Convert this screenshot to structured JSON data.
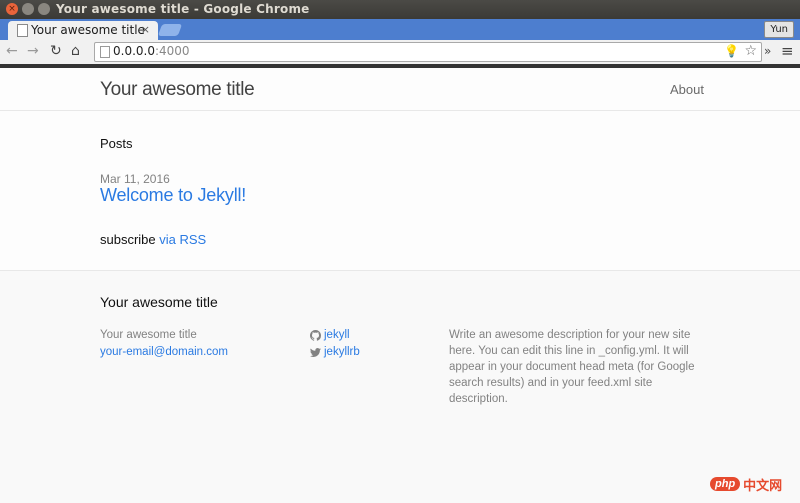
{
  "window": {
    "title": "Your awesome title - Google Chrome"
  },
  "browser": {
    "tab_title": "Your awesome title",
    "tab_close": "×",
    "profile_name": "Yun",
    "url_host": "0.0.0.0",
    "url_port": ":4000",
    "extensions_chevron": "»",
    "menu_glyph": "≡"
  },
  "site": {
    "title": "Your awesome title",
    "nav": [
      {
        "label": "About"
      }
    ]
  },
  "main": {
    "posts_heading": "Posts",
    "posts": [
      {
        "date": "Mar 11, 2016",
        "title": "Welcome to Jekyll!"
      }
    ],
    "subscribe_text": "subscribe",
    "subscribe_link": "via RSS"
  },
  "footer": {
    "heading": "Your awesome title",
    "name": "Your awesome title",
    "email": "your-email@domain.com",
    "github": {
      "icon": "github-icon",
      "username": "jekyll"
    },
    "twitter": {
      "icon": "twitter-icon",
      "username": "jekyllrb"
    },
    "description": "Write an awesome description for your new site here. You can edit this line in _config.yml. It will appear in your document head meta (for Google search results) and in your feed.xml site description."
  },
  "watermark": {
    "logo_text": "php",
    "text": "中文网"
  },
  "colors": {
    "link": "#2a7ae2",
    "tabstrip": "#4d7ecf",
    "title_bar": "#3b3a36"
  }
}
